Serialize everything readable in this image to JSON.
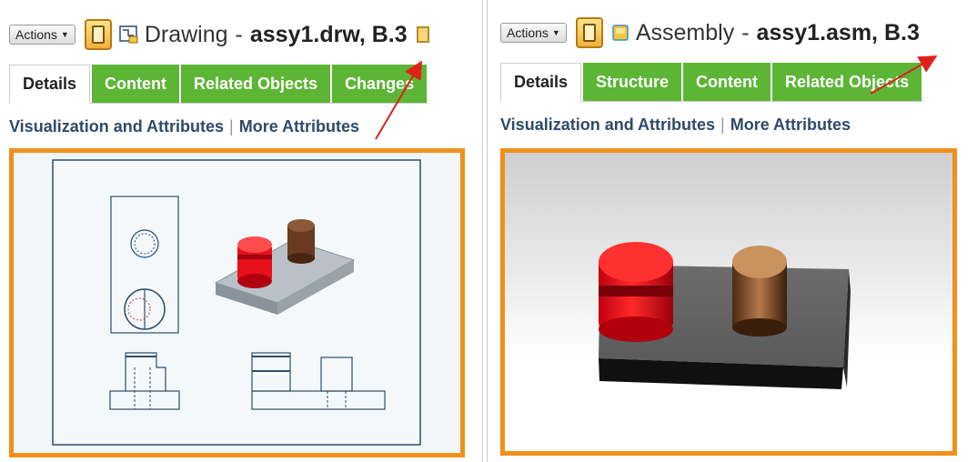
{
  "left": {
    "actions_label": "Actions",
    "type_icon": "drawing-icon",
    "title_type": "Drawing",
    "title_sep": "-",
    "title_name": "assy1.drw, B.3",
    "tabs": [
      "Details",
      "Content",
      "Related Objects",
      "Changes"
    ],
    "active_tab": "Details",
    "links": [
      "Visualization and Attributes",
      "More Attributes"
    ]
  },
  "right": {
    "actions_label": "Actions",
    "type_icon": "assembly-icon",
    "title_type": "Assembly",
    "title_sep": "-",
    "title_name": "assy1.asm, B.3",
    "tabs": [
      "Details",
      "Structure",
      "Content",
      "Related Objects"
    ],
    "active_tab": "Details",
    "links": [
      "Visualization and Attributes",
      "More Attributes"
    ]
  },
  "colors": {
    "tab_green": "#5cb534",
    "frame_orange": "#f0901a",
    "link_blue": "#2f4a6a",
    "arrow_red": "#e0201a",
    "part_red": "#e8101a",
    "part_brown": "#6a3a20"
  }
}
